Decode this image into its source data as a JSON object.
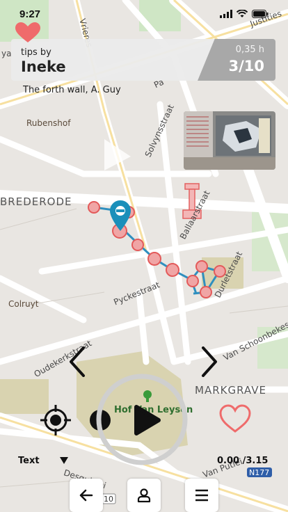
{
  "status_bar": {
    "time": "9:27"
  },
  "header": {
    "tips_by_label": "tips by",
    "author": "Ineke",
    "distance": "0,35 h",
    "step": "3/10",
    "subtitle": "The forth wall, A. Guy"
  },
  "map": {
    "streets": [
      "Vrieres",
      "Justities",
      "Pa",
      "Solvynsstraat",
      "Ballaarstraat",
      "Pyckestraat",
      "Durletstraat",
      "Van Schoonbekestraat",
      "Oudekerkstraat",
      "Desguinlei",
      "Van Putlei",
      "ya"
    ],
    "areas": [
      "BREDERODE",
      "MARKGRAVE"
    ],
    "pois": [
      "Rubenshof",
      "Colruyt",
      "Hof Van Leysen"
    ],
    "road_badges": [
      "N177",
      "10"
    ]
  },
  "controls": {
    "text_toggle_label": "Text",
    "playback_time": "0.00 /3.15"
  },
  "icons": {
    "favorite_top": "heart-icon",
    "location": "crosshair-icon",
    "record": "record-icon",
    "play": "play-icon",
    "favorite": "heart-outline-icon",
    "prev": "chevron-left-icon",
    "next": "chevron-right-icon",
    "back": "arrow-left-icon",
    "profile": "person-icon",
    "menu": "hamburger-icon"
  },
  "colors": {
    "route": "#2f8fbf",
    "pin": "#1a8fba",
    "stop_fill": "#f0a5a5",
    "stop_stroke": "#e35a5a",
    "heart": "#ef6b6b"
  }
}
